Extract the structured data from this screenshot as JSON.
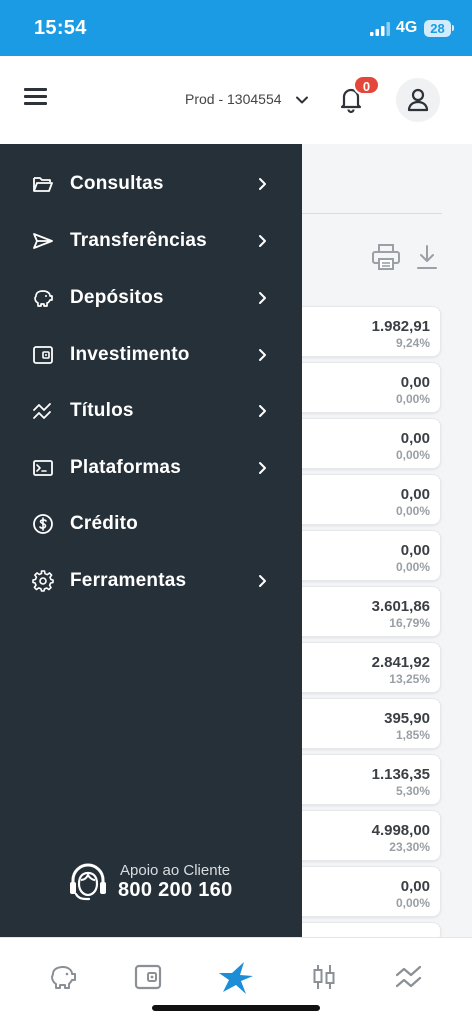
{
  "status_bar": {
    "time": "15:54",
    "network": "4G",
    "battery": "28"
  },
  "header": {
    "account_label": "Prod - 1304554",
    "notifications_count": "0"
  },
  "menu": {
    "items": [
      {
        "label": "Consultas",
        "icon": "folder-open-icon",
        "has_submenu": true
      },
      {
        "label": "Transferências",
        "icon": "send-icon",
        "has_submenu": true
      },
      {
        "label": "Depósitos",
        "icon": "piggy-bank-icon",
        "has_submenu": true
      },
      {
        "label": "Investimento",
        "icon": "wallet-icon",
        "has_submenu": true
      },
      {
        "label": "Títulos",
        "icon": "chart-zigzag-icon",
        "has_submenu": true
      },
      {
        "label": "Plataformas",
        "icon": "terminal-icon",
        "has_submenu": true
      },
      {
        "label": "Crédito",
        "icon": "dollar-circle-icon",
        "has_submenu": false
      },
      {
        "label": "Ferramentas",
        "icon": "gear-icon",
        "has_submenu": true
      }
    ],
    "support": {
      "label": "Apoio ao Cliente",
      "phone": "800 200 160"
    }
  },
  "rows": [
    {
      "value": "1.982,91",
      "percent": "9,24%"
    },
    {
      "value": "0,00",
      "percent": "0,00%"
    },
    {
      "value": "0,00",
      "percent": "0,00%"
    },
    {
      "value": "0,00",
      "percent": "0,00%"
    },
    {
      "value": "0,00",
      "percent": "0,00%"
    },
    {
      "value": "3.601,86",
      "percent": "16,79%"
    },
    {
      "value": "2.841,92",
      "percent": "13,25%"
    },
    {
      "value": "395,90",
      "percent": "1,85%"
    },
    {
      "value": "1.136,35",
      "percent": "5,30%"
    },
    {
      "value": "4.998,00",
      "percent": "23,30%"
    },
    {
      "value": "0,00",
      "percent": "0,00%"
    }
  ],
  "bottom_nav": [
    {
      "icon": "piggy-bank-icon",
      "active": false
    },
    {
      "icon": "wallet-icon",
      "active": false
    },
    {
      "icon": "star-icon",
      "active": true
    },
    {
      "icon": "candlestick-icon",
      "active": false
    },
    {
      "icon": "chart-zigzag-icon",
      "active": false
    }
  ],
  "colors": {
    "brand": "#1b9be3",
    "drawer": "#263039",
    "badge": "#e5463a"
  }
}
